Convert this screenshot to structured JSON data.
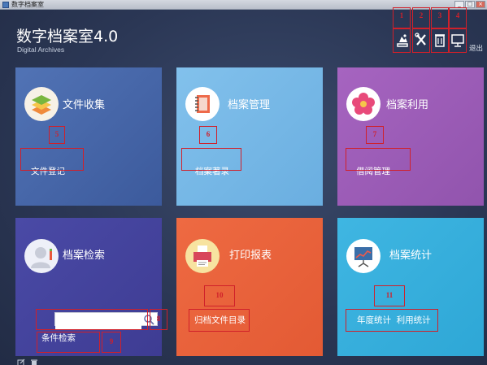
{
  "window": {
    "title": "数字档案室"
  },
  "header": {
    "title": "数字档案室4.0",
    "subtitle": "Digital Archives",
    "exit_label": "退出",
    "tools": [
      {
        "icon": "backup-icon",
        "annotation": "1"
      },
      {
        "icon": "tools-icon",
        "annotation": "2"
      },
      {
        "icon": "trash-icon",
        "annotation": "3"
      },
      {
        "icon": "monitor-icon",
        "annotation": "4"
      }
    ]
  },
  "tiles": [
    {
      "title": "文件收集",
      "action": "文件登记",
      "icon": "layers-icon",
      "annotation": "5",
      "color": "#4a6aae"
    },
    {
      "title": "档案管理",
      "action": "档案著录",
      "icon": "notebook-icon",
      "annotation": "6",
      "color": "#78b8e8"
    },
    {
      "title": "档案利用",
      "action": "借阅管理",
      "icon": "flower-icon",
      "annotation": "7",
      "color": "#9b5ab5"
    },
    {
      "title": "档案检索",
      "action": "条件检索",
      "icon": "user-search-icon",
      "annotation": "9",
      "search_annotation": "8",
      "search_placeholder": "",
      "color": "#4444a0"
    },
    {
      "title": "打印报表",
      "action": "归档文件目录",
      "icon": "printer-icon",
      "annotation": "10",
      "color": "#e9623a"
    },
    {
      "title": "档案统计",
      "action": "年度统计  利用统计",
      "icon": "chart-board-icon",
      "annotation": "11",
      "color": "#36aedc"
    }
  ]
}
